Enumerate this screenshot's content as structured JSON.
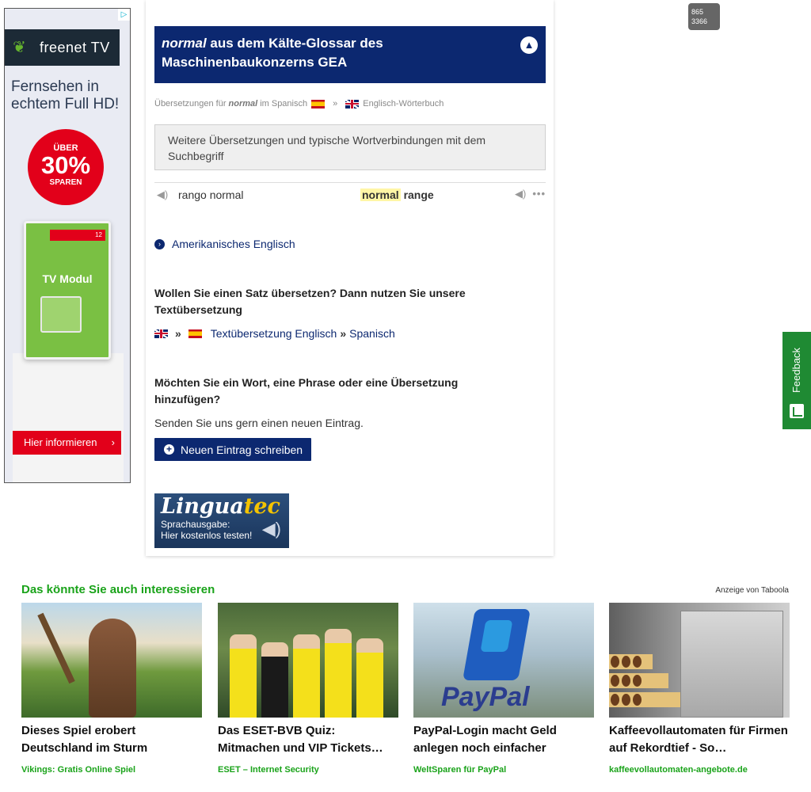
{
  "left_ad": {
    "choices_icon": "adchoices-icon",
    "brand": "freenet TV",
    "headline": "Fernsehen in echtem Full HD!",
    "badge_line1": "ÜBER",
    "badge_line2": "30%",
    "badge_line3": "SPAREN",
    "product_title": "TV Modul",
    "product_tag": "12",
    "cta": "Hier informieren",
    "cta_arrow": "›",
    "brand_color": "#e2001a"
  },
  "banner": {
    "title_em": "normal",
    "title_rest": " aus dem Kälte-Glossar des Maschinenbaukonzerns GEA",
    "collapse_icon": "chevron-up-icon",
    "collapse_glyph": "︿"
  },
  "breadcrumb": {
    "prefix": "Übersetzungen für",
    "term": "normal",
    "middle": "im Spanisch",
    "sep": "»",
    "dict": "Englisch-Wörterbuch"
  },
  "more_box": {
    "text": "Weitere Übersetzungen und typische Wortverbindungen mit dem Suchbegriff"
  },
  "result": {
    "left": "rango normal",
    "right_highlight": "normal",
    "right_rest": " range",
    "speaker_glyph": "🔈",
    "more_glyph": "•••"
  },
  "american_link": {
    "label": "Amerikanisches Englisch",
    "glyph": "›"
  },
  "sentence_section": {
    "question": "Wollen Sie einen Satz übersetzen? Dann nutzen Sie unsere Textübersetzung",
    "sep": "»",
    "link_label": "Textübersetzung Englisch",
    "link_target": "Spanisch"
  },
  "add_section": {
    "question": "Möchten Sie ein Wort, eine Phrase oder eine Übersetzung hinzufügen?",
    "sub": "Senden Sie uns gern einen neuen Eintrag.",
    "button_label": "Neuen Eintrag schreiben",
    "button_plus": "+"
  },
  "linguatec": {
    "logo_a": "Lingua",
    "logo_b": "tec",
    "line1": "Sprachausgabe:",
    "line2": "Hier kostenlos testen!",
    "speaker_glyph": "🔊"
  },
  "counter": {
    "line1": "865",
    "line2": "3366"
  },
  "feedback": {
    "label": "Feedback"
  },
  "taboola": {
    "title": "Das könnte Sie auch interessieren",
    "ads_label": "Anzeige von Taboola",
    "accent_color": "#1aa31a",
    "cards": [
      {
        "headline": "Dieses Spiel erobert Deutschland im Sturm",
        "source": "Vikings: Gratis Online Spiel"
      },
      {
        "headline": "Das ESET-BVB Quiz: Mitmachen und VIP Tickets…",
        "source": "ESET – Internet Security"
      },
      {
        "headline": "PayPal-Login macht Geld anlegen noch einfacher",
        "source": "WeltSparen für PayPal"
      },
      {
        "headline": "Kaffeevollautomaten für Firmen auf Rekordtief - So…",
        "source": "kaffeevollautomaten-angebote.de"
      }
    ],
    "paypal_logo_text": "PayPal"
  }
}
